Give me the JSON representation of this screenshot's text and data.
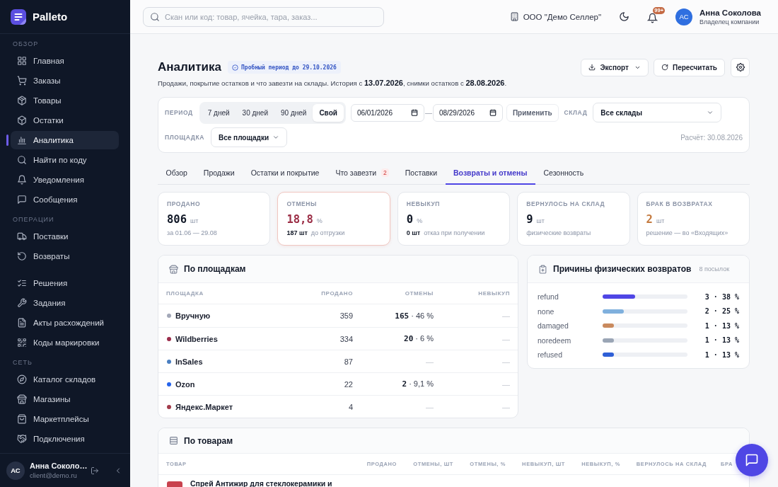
{
  "sidebar": {
    "brand": "Palleto",
    "sections": [
      {
        "title": "ОБЗОР",
        "items": [
          {
            "label": "Главная",
            "selected": false
          },
          {
            "label": "Заказы",
            "selected": false
          },
          {
            "label": "Товары",
            "selected": false
          },
          {
            "label": "Остатки",
            "selected": false
          },
          {
            "label": "Аналитика",
            "selected": true
          },
          {
            "label": "Найти по коду",
            "selected": false
          },
          {
            "label": "Уведомления",
            "selected": false
          },
          {
            "label": "Сообщения",
            "selected": false
          }
        ]
      },
      {
        "title": "ОПЕРАЦИИ",
        "items": [
          {
            "label": "Поставки",
            "selected": false
          },
          {
            "label": "Возвраты",
            "selected": false
          }
        ]
      },
      {
        "items": [
          {
            "label": "Решения",
            "selected": false
          },
          {
            "label": "Задания",
            "selected": false
          },
          {
            "label": "Акты расхождений",
            "selected": false
          },
          {
            "label": "Коды маркировки",
            "selected": false
          }
        ]
      },
      {
        "title": "СЕТЬ",
        "items": [
          {
            "label": "Каталог складов",
            "selected": false
          },
          {
            "label": "Магазины",
            "selected": false
          },
          {
            "label": "Маркетплейсы",
            "selected": false
          },
          {
            "label": "Подключения",
            "selected": false
          }
        ]
      }
    ],
    "user": {
      "initials": "АС",
      "name": "Анна Соколо…",
      "email": "client@demo.ru"
    }
  },
  "topbar": {
    "search": {
      "placeholder": "Скан или код: товар, ячейка, тара, заказ..."
    },
    "company": "ООО \"Демо Селлер\"",
    "notifications_badge": "99+",
    "user": {
      "initials": "АС",
      "name": "Анна Соколова",
      "role": "Владелец компании"
    }
  },
  "page": {
    "title": "Аналитика",
    "trial_badge": "Пробный период до 29.10.2026",
    "subtitle": "Продажи, покрытие остатков и что завезти на склады. История с **13.07.2026**, снимки остатков с **28.08.2026**.",
    "actions": [
      {
        "label": "Экспорт",
        "kind": "export"
      },
      {
        "label": "Пересчитать",
        "kind": "recalculate"
      }
    ]
  },
  "filters": {
    "period": {
      "label": "ПЕРИОД",
      "options": [
        {
          "label": "7 дней",
          "selected": false
        },
        {
          "label": "30 дней",
          "selected": false
        },
        {
          "label": "90 дней",
          "selected": false
        },
        {
          "label": "Свой",
          "selected": true
        }
      ]
    },
    "date_from": "06/01/2026",
    "date_separator": "—",
    "date_to": "08/29/2026",
    "apply": "Применить",
    "warehouse": {
      "label": "СКЛАД",
      "value": "Все склады"
    },
    "marketplace": {
      "label": "ПЛОЩАДКА",
      "value": "Все площадки"
    },
    "calculated": "Расчёт: 30.08.2026"
  },
  "tabs": [
    {
      "label": "Обзор",
      "selected": false
    },
    {
      "label": "Продажи",
      "selected": false
    },
    {
      "label": "Остатки и покрытие",
      "selected": false
    },
    {
      "label": "Что завезти",
      "badge": "2",
      "selected": false
    },
    {
      "label": "Поставки",
      "selected": false
    },
    {
      "label": "Возвраты и отмены",
      "selected": true
    },
    {
      "label": "Сезонность",
      "selected": false
    }
  ],
  "kpis": [
    {
      "label": "ПРОДАНО",
      "value": "806",
      "unit": "шт",
      "note": "за 01.06 — 29.08",
      "color": "#111827",
      "highlighted": false
    },
    {
      "label": "ОТМЕНЫ",
      "value": "18,8",
      "unit": "%",
      "note": "**187 шт**  до отгрузки",
      "color": "#9b2d45",
      "highlighted": true
    },
    {
      "label": "НЕВЫКУП",
      "value": "0",
      "unit": "%",
      "note": "**0 шт**  отказ при получении",
      "color": "#111827",
      "highlighted": false
    },
    {
      "label": "ВЕРНУЛОСЬ НА СКЛАД",
      "value": "9",
      "unit": "шт",
      "note": "физические возвраты",
      "color": "#111827",
      "highlighted": false
    },
    {
      "label": "БРАК В ВОЗВРАТАХ",
      "value": "2",
      "unit": "шт",
      "note": "решение — во «Входящих»",
      "color": "#c47a3f",
      "highlighted": false
    }
  ],
  "platforms": {
    "title": "По площадкам",
    "columns": [
      "ПЛОЩАДКА",
      "ПРОДАНО",
      "ОТМЕНЫ",
      "НЕВЫКУП"
    ],
    "rows": [
      {
        "name": "Вручную",
        "color": "#a3a8b8",
        "sold": "359",
        "cancels": {
          "text": "**165** · 46 %",
          "kind": "value"
        },
        "nonpurchase": {
          "text": "—",
          "kind": "empty"
        }
      },
      {
        "name": "Wildberries",
        "color": "#9b2c4a",
        "sold": "334",
        "cancels": {
          "text": "**20** · 6 %",
          "kind": "value"
        },
        "nonpurchase": {
          "text": "—",
          "kind": "empty"
        }
      },
      {
        "name": "InSales",
        "color": "#4a7fc1",
        "sold": "87",
        "cancels": {
          "text": "—",
          "kind": "empty"
        },
        "nonpurchase": {
          "text": "—",
          "kind": "empty"
        }
      },
      {
        "name": "Ozon",
        "color": "#2563eb",
        "sold": "22",
        "cancels": {
          "text": "**2** · 9,1 %",
          "kind": "value"
        },
        "nonpurchase": {
          "text": "—",
          "kind": "empty"
        }
      },
      {
        "name": "Яндекс.Маркет",
        "color": "#a23b4a",
        "sold": "4",
        "cancels": {
          "text": "—",
          "kind": "empty"
        },
        "nonpurchase": {
          "text": "—",
          "kind": "empty"
        }
      }
    ]
  },
  "reasons": {
    "title": "Причины физических возвратов",
    "count": "8 посылок",
    "rows": [
      {
        "label": "refund",
        "color": "#4f46e5",
        "level": 0.38,
        "value": "3 · 38 %"
      },
      {
        "label": "none",
        "color": "#7fb0dd",
        "level": 0.25,
        "value": "2 · 25 %"
      },
      {
        "label": "damaged",
        "color": "#c98a5e",
        "level": 0.13,
        "value": "1 · 13 %"
      },
      {
        "label": "noredeem",
        "color": "#9aa5b5",
        "level": 0.13,
        "value": "1 · 13 %"
      },
      {
        "label": "refused",
        "color": "#2f5fd6",
        "level": 0.13,
        "value": "1 · 13 %"
      }
    ]
  },
  "products": {
    "title": "По товарам",
    "columns": [
      "ТОВАР",
      "ПРОДАНО",
      "ОТМЕНЫ, ШТ",
      "ОТМЕНЫ, %",
      "НЕВЫКУП, ШТ",
      "НЕВЫКУП, %",
      "ВЕРНУЛОСЬ НА СКЛАД",
      "БРА"
    ],
    "rows": [
      {
        "name": "Спрей Антижир для стеклокерамики и"
      }
    ]
  }
}
